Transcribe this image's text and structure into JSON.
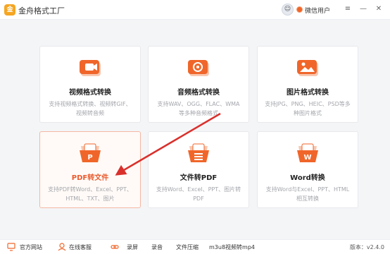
{
  "app": {
    "title": "金舟格式工厂",
    "logo_letter": "金"
  },
  "user": {
    "name": "微信用户",
    "avatar_glyph": "☺"
  },
  "window_controls": {
    "menu": "≡",
    "minimize": "—",
    "close": "✕"
  },
  "cards": [
    {
      "title": "视频格式转换",
      "desc": "支持视频格式转换、视频转GIF、视频转音频",
      "icon": "video-convert-icon",
      "selected": false
    },
    {
      "title": "音频格式转换",
      "desc": "支持WAV、OGG、FLAC、WMA等多种音频格式",
      "icon": "audio-convert-icon",
      "selected": false
    },
    {
      "title": "图片格式转换",
      "desc": "支持JPG、PNG、HEIC、PSD等多种图片格式",
      "icon": "image-convert-icon",
      "selected": false
    },
    {
      "title": "PDF转文件",
      "desc": "支持PDF转Word、Excel、PPT、HTML、TXT、图片",
      "icon": "pdf-convert-icon",
      "icon_letter": "P",
      "selected": true
    },
    {
      "title": "文件转PDF",
      "desc": "支持Word、Excel、PPT、图片转PDF",
      "icon": "file-to-pdf-icon",
      "selected": false
    },
    {
      "title": "Word转换",
      "desc": "支持Word与Excel、PPT、HTML相互转换",
      "icon": "word-convert-icon",
      "icon_letter": "W",
      "selected": false
    }
  ],
  "statusbar": {
    "website": "官方网站",
    "support": "在线客服",
    "record_screen": "录屏",
    "record_audio": "录音",
    "compress": "文件压缩",
    "m3u8": "m3u8视频转mp4",
    "version": "版本：v2.4.0"
  },
  "colors": {
    "accent": "#f0662a",
    "arrow": "#d9302c"
  }
}
